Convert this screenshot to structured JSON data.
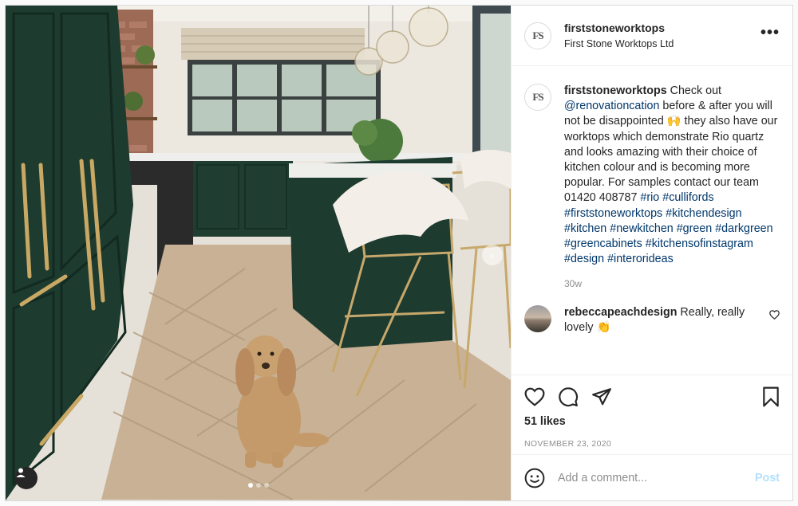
{
  "post": {
    "media": {
      "image_alt": "Green kitchen with brass handles, island with gold bar stools and a spaniel sitting on herringbone wood floor",
      "carousel_position": 1,
      "carousel_count": 3,
      "icons": {
        "user_tag": "user-icon",
        "next": "chevron-right-icon"
      }
    },
    "header": {
      "avatar_text": "FS",
      "username": "firststoneworktops",
      "subtitle": "First Stone Worktops Ltd",
      "more_icon": "more-options-icon",
      "more_label": "•••"
    },
    "caption": {
      "avatar_text": "FS",
      "username": "firststoneworktops",
      "text_1": " Check out ",
      "mention": "@renovationcation",
      "text_2": " before & after you will not be disappointed 🙌 they also have our worktops which demonstrate Rio quartz and looks amazing with their choice of kitchen colour and is becoming more popular. For samples contact our team 01420 408787 ",
      "hashtags": [
        "#rio",
        "#cullifords",
        "#firststoneworktops",
        "#kitchendesign",
        "#kitchen",
        "#newkitchen",
        "#green",
        "#darkgreen",
        "#greencabinets",
        "#kitchensofinstagram",
        "#design",
        "#interorideas"
      ],
      "age": "30w"
    },
    "comments": [
      {
        "username": "rebeccapeachdesign",
        "text": " Really, really lovely 👏",
        "like_icon": "heart-icon"
      }
    ],
    "actions": {
      "icons": [
        "heart-icon",
        "comment-icon",
        "share-icon",
        "bookmark-icon"
      ],
      "likes": "51 likes",
      "date": "NOVEMBER 23, 2020"
    },
    "add_comment": {
      "emoji_icon": "smiley-icon",
      "placeholder": "Add a comment...",
      "post_label": "Post",
      "post_color": "#b2dffc"
    },
    "colors": {
      "link": "#00376b",
      "secondary_text": "#8e8e8e",
      "border": "#dbdbdb"
    }
  }
}
